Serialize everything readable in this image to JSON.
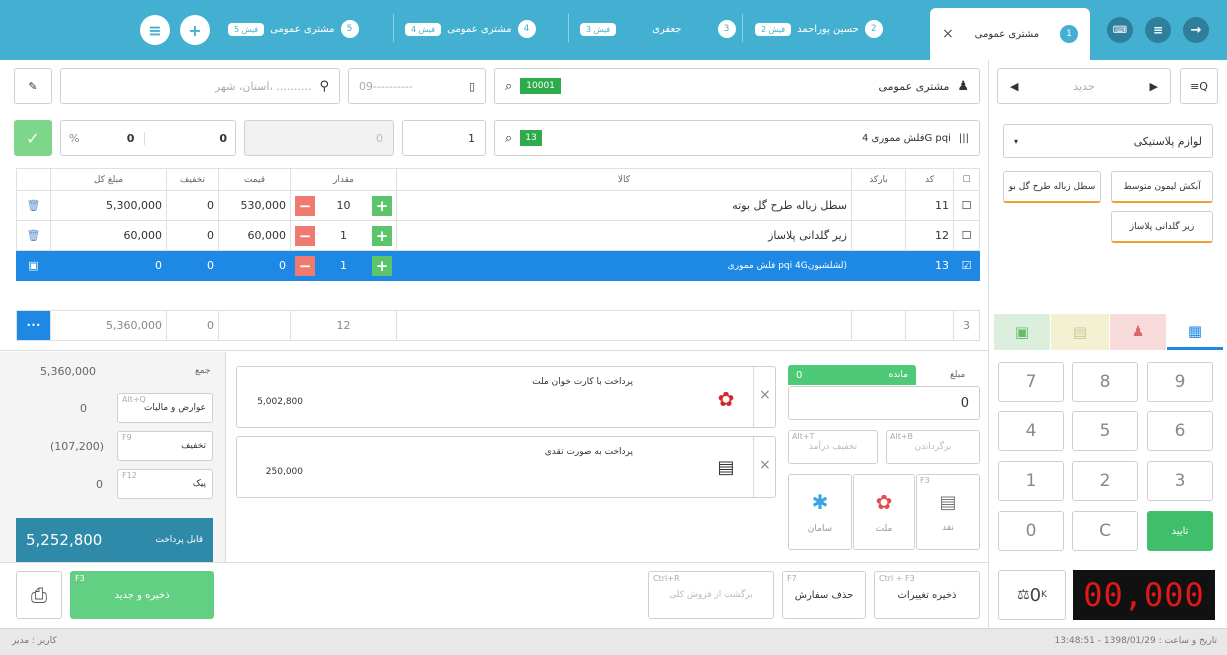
{
  "tabs": {
    "t1": {
      "label": "مشتری عمومی",
      "num": "1"
    },
    "t2": {
      "label": "حسین پوراحمد",
      "num": "2",
      "pill": "فیش 2"
    },
    "t3": {
      "label": "جعفری",
      "num": "3",
      "pill": "فیش 3"
    },
    "t4": {
      "label": "مشتری عمومی",
      "num": "4",
      "pill": "فیش 4"
    },
    "t5": {
      "label": "مشتری عمومی",
      "num": "5",
      "pill": "فیش 5"
    },
    "close": "×"
  },
  "nav": {
    "new_placeholder": "جدید",
    "category": "لوازم پلاستیکی"
  },
  "cat_buttons": [
    "آبکش لیمون متوسط",
    "سطل زباله طرح گل بو",
    "زیر گلدانی پلاساز"
  ],
  "customer": {
    "name": "مشتری عمومی",
    "code": "10001",
    "phone": "09----------",
    "address": "استان، شهر، .........."
  },
  "entry": {
    "product": "فلش مموری 4G pqi",
    "code": "13",
    "qty": "1",
    "price": "0",
    "discount": "0",
    "percent": "%",
    "disc_val": "0"
  },
  "table": {
    "headers": {
      "check": "",
      "code": "کد",
      "barcode": "بارکد",
      "item": "کالا",
      "qty": "مقدار",
      "price": "قیمت",
      "discount": "تخفیف",
      "total": "مبلغ کل"
    },
    "rows": [
      {
        "code": "11",
        "name": "سطل زباله طرح گل بوته",
        "qty": "10",
        "price": "530,000",
        "discount": "0",
        "total": "5,300,000"
      },
      {
        "code": "12",
        "name": "زیر گلدانی پلاساز",
        "qty": "1",
        "price": "60,000",
        "discount": "0",
        "total": "60,000"
      },
      {
        "code": "13",
        "name": "فلش مموری pqi 4Gلشلشیون)",
        "qty": "1",
        "price": "0",
        "discount": "0",
        "total": "0"
      }
    ],
    "footer": {
      "count": "3",
      "qty": "12",
      "discount": "0",
      "total": "5,360,000",
      "more": "•••"
    }
  },
  "summary": {
    "sum_label": "جمع",
    "sum": "5,360,000",
    "tax_label": "عوارض و مالیات",
    "tax_key": "Alt+Q",
    "tax": "0",
    "discount_label": "تخفیف",
    "discount_key": "F9",
    "discount": "(107,200)",
    "courier_label": "پیک",
    "courier_key": "F12",
    "courier": "0",
    "payable_label": "قابل پرداخت",
    "payable": "5,252,800"
  },
  "payments": [
    {
      "title": "پرداخت با کارت خوان ملت",
      "amount": "5,002,800"
    },
    {
      "title": "پرداخت به صورت نقدی",
      "amount": "250,000"
    }
  ],
  "pay_panel": {
    "remain": "مانده",
    "remain_val": "0",
    "amount_label": "مبلغ",
    "amount": "0",
    "return_label": "برگرداندن",
    "return_key": "Alt+B",
    "discount_label": "تخفیف درآمد",
    "discount_key": "Alt+T",
    "cash": "نقد",
    "cash_key": "F3",
    "mellat": "ملت",
    "saman": "سامان"
  },
  "numpad": [
    "7",
    "8",
    "9",
    "4",
    "5",
    "6",
    "1",
    "2",
    "3",
    "0",
    "C",
    "تایید"
  ],
  "bottom": {
    "print_icon": "printer-icon",
    "save_new": "ذخیره و جدید",
    "save_new_key": "F3",
    "return_sale": "برگشت از فروش کلی",
    "return_sale_key": "Ctrl+R",
    "delete_order": "حذف سفارش",
    "delete_key": "F7",
    "save_changes": "ذخیره تغییرات",
    "save_changes_key": "Ctrl + F3",
    "display": "00,000",
    "scale": "0",
    "scale_unit": "K"
  },
  "status": {
    "user": "کاربر : مدیر",
    "datetime": "تاریخ و ساعت : 1398/01/29 - 13:48:51"
  }
}
